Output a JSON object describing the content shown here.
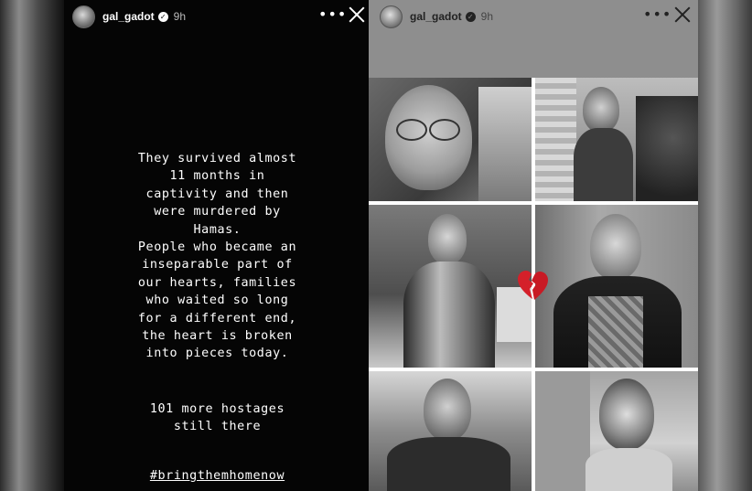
{
  "left_story": {
    "username": "gal_gadot",
    "time": "9h",
    "text_main": "They survived almost\n11 months in\ncaptivity and then\nwere murdered by\nHamas.\nPeople who became an\ninseparable part of\nour hearts, families\nwho waited so long\nfor a different end,\nthe heart is broken\ninto pieces today.",
    "text_secondary": "101 more hostages\nstill there",
    "hashtag": "#bringthemhomenow"
  },
  "right_story": {
    "username": "gal_gadot",
    "time": "9h",
    "sticker": "broken-heart-icon"
  },
  "icons": {
    "more": "more-options-icon",
    "close": "close-icon",
    "verified": "verified-badge-icon"
  },
  "colors": {
    "left_bg": "#050505",
    "right_bg": "#8e8e8e",
    "heart": "#d4202a"
  }
}
